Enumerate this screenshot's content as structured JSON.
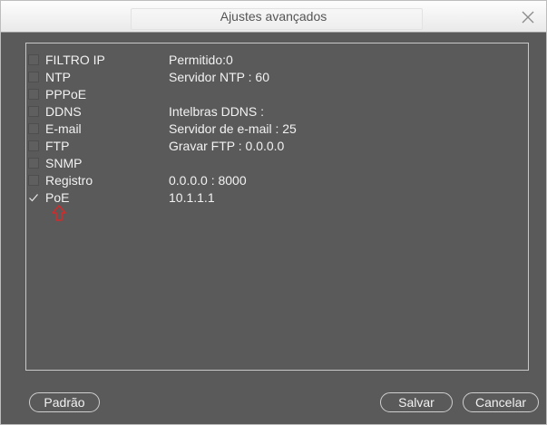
{
  "window": {
    "title": "Ajustes avançados",
    "close_icon": "close-icon"
  },
  "services": [
    {
      "name": "FILTRO IP",
      "value": "Permitido:0",
      "checked": false
    },
    {
      "name": "NTP",
      "value": "Servidor NTP : 60",
      "checked": false
    },
    {
      "name": "PPPoE",
      "value": "",
      "checked": false
    },
    {
      "name": "DDNS",
      "value": "Intelbras DDNS :",
      "checked": false
    },
    {
      "name": "E-mail",
      "value": "Servidor de e-mail : 25",
      "checked": false
    },
    {
      "name": "FTP",
      "value": "Gravar FTP : 0.0.0.0",
      "checked": false
    },
    {
      "name": "SNMP",
      "value": "",
      "checked": false
    },
    {
      "name": "Registro",
      "value": "0.0.0.0 : 8000",
      "checked": false
    },
    {
      "name": "PoE",
      "value": "10.1.1.1",
      "checked": true
    }
  ],
  "annotation": {
    "icon": "red-up-arrow-icon",
    "color": "#d32b2b"
  },
  "buttons": {
    "default_label": "Padrão",
    "save_label": "Salvar",
    "cancel_label": "Cancelar"
  }
}
